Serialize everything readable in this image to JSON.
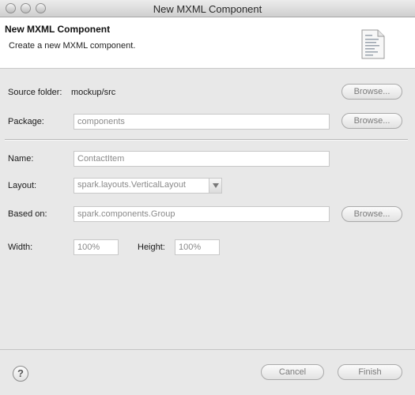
{
  "window": {
    "title": "New MXML Component"
  },
  "header": {
    "title": "New MXML Component",
    "description": "Create a new MXML component.",
    "icon": "document-icon"
  },
  "form": {
    "source_folder": {
      "label": "Source folder:",
      "value": "mockup/src",
      "browse_label": "Browse..."
    },
    "package": {
      "label": "Package:",
      "value": "components",
      "browse_label": "Browse..."
    },
    "name": {
      "label": "Name:",
      "value": "ContactItem"
    },
    "layout": {
      "label": "Layout:",
      "value": "spark.layouts.VerticalLayout"
    },
    "based_on": {
      "label": "Based on:",
      "value": "spark.components.Group",
      "browse_label": "Browse..."
    },
    "width": {
      "label": "Width:",
      "value": "100%"
    },
    "height": {
      "label": "Height:",
      "value": "100%"
    }
  },
  "footer": {
    "help_icon": "help-icon",
    "help_glyph": "?",
    "cancel_label": "Cancel",
    "finish_label": "Finish"
  },
  "colors": {
    "header_bg": "#ffffff",
    "dialog_bg": "#e8e8e8",
    "disabled_text": "#7a7a7a"
  }
}
